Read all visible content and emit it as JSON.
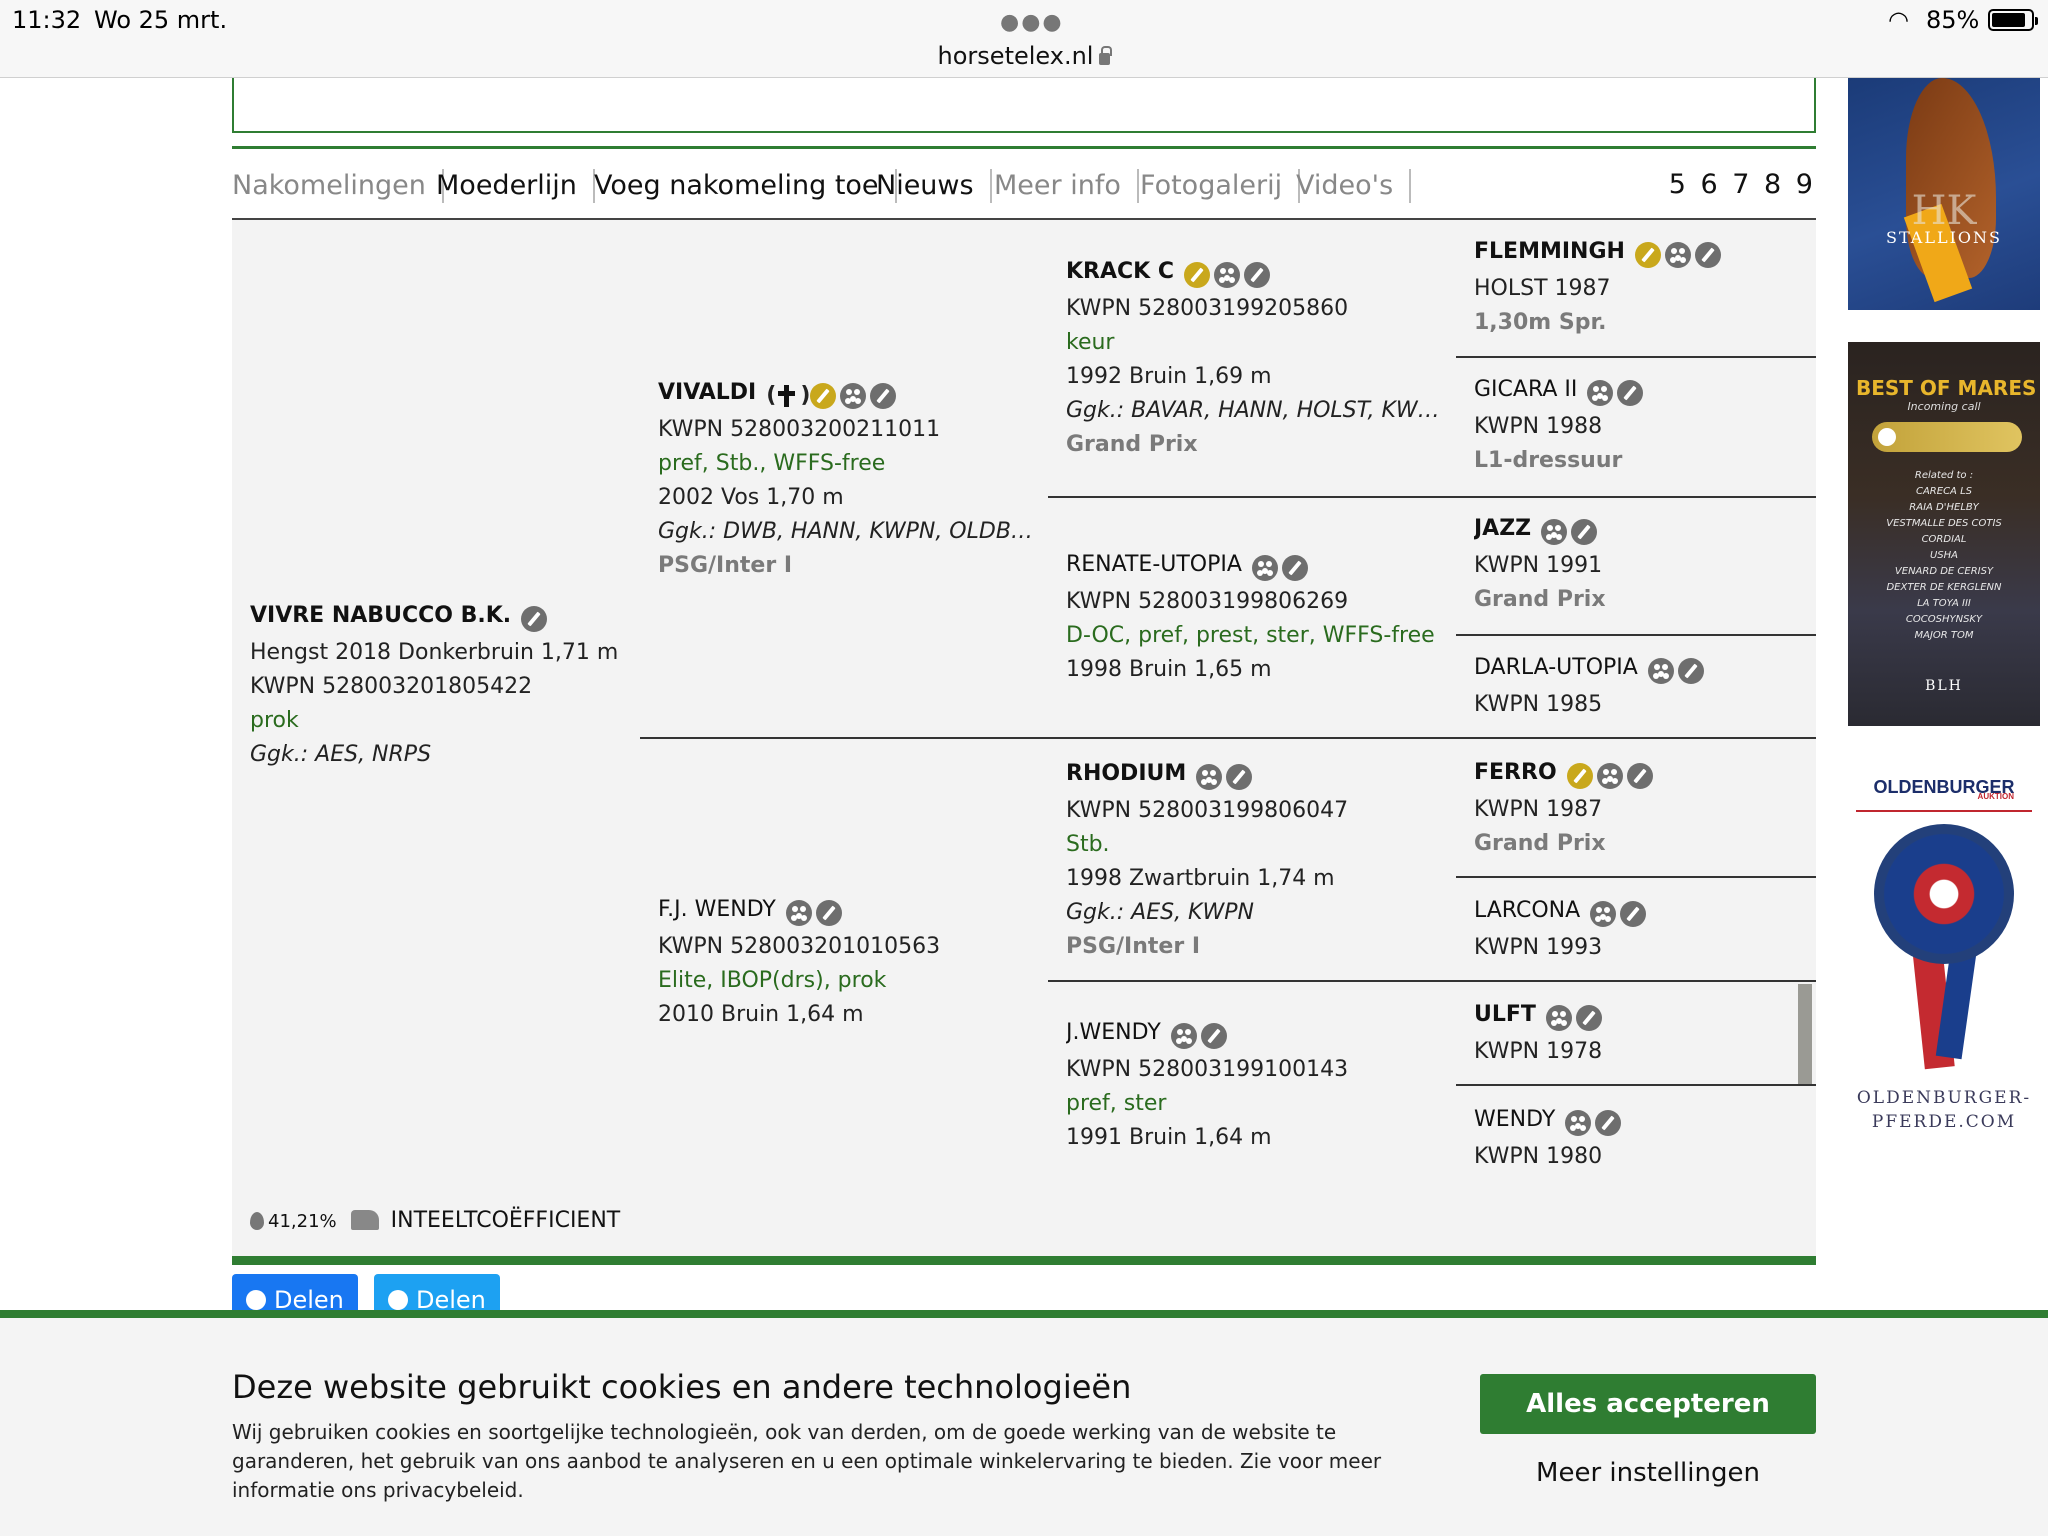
{
  "status_bar": {
    "time": "11:32",
    "date": "Wo 25 mrt.",
    "url": "horsetelex.nl",
    "battery": "85%"
  },
  "tabs": [
    {
      "label": "Nakomelingen"
    },
    {
      "label": "Moederlijn"
    },
    {
      "label": "Voeg nakomeling toe"
    },
    {
      "label": "Nieuws"
    },
    {
      "label": "Meer info"
    },
    {
      "label": "Fotogalerij"
    },
    {
      "label": "Video's"
    }
  ],
  "pages": "5 6 7 8 9",
  "pedigree": {
    "subject": {
      "name": "VIVRE NABUCCO B.K.",
      "details": "Hengst 2018 Donkerbruin 1,71 m",
      "reg": "KWPN 528003201805422",
      "predicates": "prok",
      "studbooks": "Ggk.: AES, NRPS"
    },
    "sire": {
      "name": "VIVALDI",
      "reg": "KWPN 528003200211011",
      "predicates": "pref, Stb., WFFS-free",
      "details": "2002 Vos 1,70 m",
      "studbooks": "Ggk.: DWB, HANN, KWPN, OLDBG, R...",
      "level": "PSG/Inter I"
    },
    "dam": {
      "name": "F.J. WENDY",
      "reg": "KWPN 528003201010563",
      "predicates": "Elite, IBOP(drs), prok",
      "details": "2010 Bruin 1,64 m"
    },
    "ss": {
      "name": "KRACK C",
      "reg": "KWPN 528003199205860",
      "predicates": "keur",
      "details": "1992 Bruin 1,69 m",
      "studbooks": "Ggk.: BAVAR, HANN, HOLST, KWPN, ...",
      "level": "Grand Prix"
    },
    "sd": {
      "name": "RENATE-UTOPIA",
      "reg": "KWPN 528003199806269",
      "predicates": "D-OC, pref, prest, ster, WFFS-free",
      "details": "1998 Bruin 1,65 m"
    },
    "ds": {
      "name": "RHODIUM",
      "reg": "KWPN 528003199806047",
      "predicates": "Stb.",
      "details": "1998 Zwartbruin 1,74 m",
      "studbooks": "Ggk.: AES, KWPN",
      "level": "PSG/Inter I"
    },
    "dd": {
      "name": "J.WENDY",
      "reg": "KWPN 528003199100143",
      "predicates": "pref, ster",
      "details": "1991 Bruin 1,64 m"
    },
    "g4": [
      {
        "name": "FLEMMINGH",
        "reg": "HOLST 1987",
        "level": "1,30m Spr."
      },
      {
        "name": "GICARA II",
        "reg": "KWPN 1988",
        "level": "L1-dressuur"
      },
      {
        "name": "JAZZ",
        "reg": "KWPN 1991",
        "level": "Grand Prix"
      },
      {
        "name": "DARLA-UTOPIA",
        "reg": "KWPN 1985"
      },
      {
        "name": "FERRO",
        "reg": "KWPN 1987",
        "level": "Grand Prix"
      },
      {
        "name": "LARCONA",
        "reg": "KWPN 1993"
      },
      {
        "name": "ULFT",
        "reg": "KWPN 1978"
      },
      {
        "name": "WENDY",
        "reg": "KWPN 1980"
      }
    ]
  },
  "inbreeding": {
    "percent": "41,21%",
    "label": "INTEELTCOËFFICIENT"
  },
  "share": {
    "facebook": "Delen",
    "twitter": "Delen"
  },
  "cookie": {
    "title": "Deze website gebruikt cookies en andere technologieën",
    "text": "Wij gebruiken cookies en soortgelijke technologieën, ook van derden, om de goede werking van de website te garanderen, het gebruik van ons aanbod te analyseren en u een optimale winkelervaring te bieden. Zie voor meer informatie ons privacybeleid.",
    "accept": "Alles accepteren",
    "more": "Meer instellingen"
  },
  "ads": {
    "ad1": {
      "logo": "HK",
      "sub": "STALLIONS"
    },
    "ad2": {
      "title": "BEST OF MARES",
      "subtitle": "Incoming call",
      "lines": [
        "Related to :",
        "CARECA LS",
        "RAIA D'HELBY",
        "VESTMALLE DES COTIS",
        "CORDIAL",
        "USHA",
        "VENARD DE CERISY",
        "DEXTER DE KERGLENN",
        "LA TOYA III",
        "COCOSHYNSKY",
        "MAJOR TOM"
      ],
      "footer": "BLH"
    },
    "ad3": {
      "brand": "OLDENBURGER",
      "sub": "AUKTION",
      "site1": "OLDENBURGER-",
      "site2": "PFERDE.COM"
    }
  },
  "colors": {
    "accent_green": "#2f7d32",
    "predicate_green": "#2a6b1e",
    "facebook": "#1877f2",
    "twitter": "#1da1f2"
  }
}
